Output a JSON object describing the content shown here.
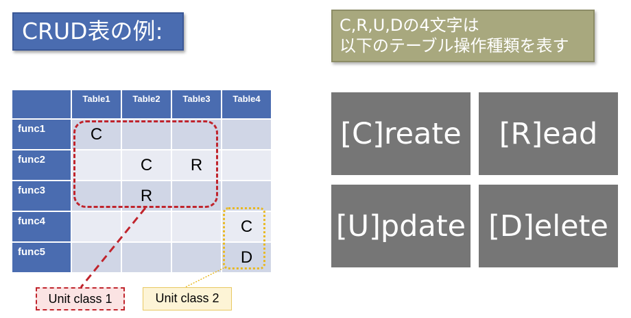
{
  "title": "CRUD表の例:",
  "note": {
    "line1": "C,R,U,Dの4文字は",
    "line2": "以下のテーブル操作種類を表す"
  },
  "table": {
    "columns": [
      "Table1",
      "Table2",
      "Table3",
      "Table4"
    ],
    "rows": [
      {
        "name": "func1",
        "cells": [
          "C",
          "",
          "",
          ""
        ]
      },
      {
        "name": "func2",
        "cells": [
          "",
          "C",
          "R",
          ""
        ]
      },
      {
        "name": "func3",
        "cells": [
          "",
          "R",
          "",
          ""
        ]
      },
      {
        "name": "func4",
        "cells": [
          "",
          "",
          "",
          "C"
        ]
      },
      {
        "name": "func5",
        "cells": [
          "",
          "",
          "",
          "D"
        ]
      }
    ]
  },
  "unit_labels": {
    "unit1": "Unit class 1",
    "unit2": "Unit class 2"
  },
  "operations": {
    "create": "[C]reate",
    "read": "[R]ead",
    "update": "[U]pdate",
    "delete": "[D]elete"
  },
  "colors": {
    "header_blue": "#4a6cb0",
    "unit1_red": "#c0242c",
    "unit2_yellow": "#e8b820",
    "op_gray": "#767676",
    "note_olive": "#a8a87e"
  }
}
